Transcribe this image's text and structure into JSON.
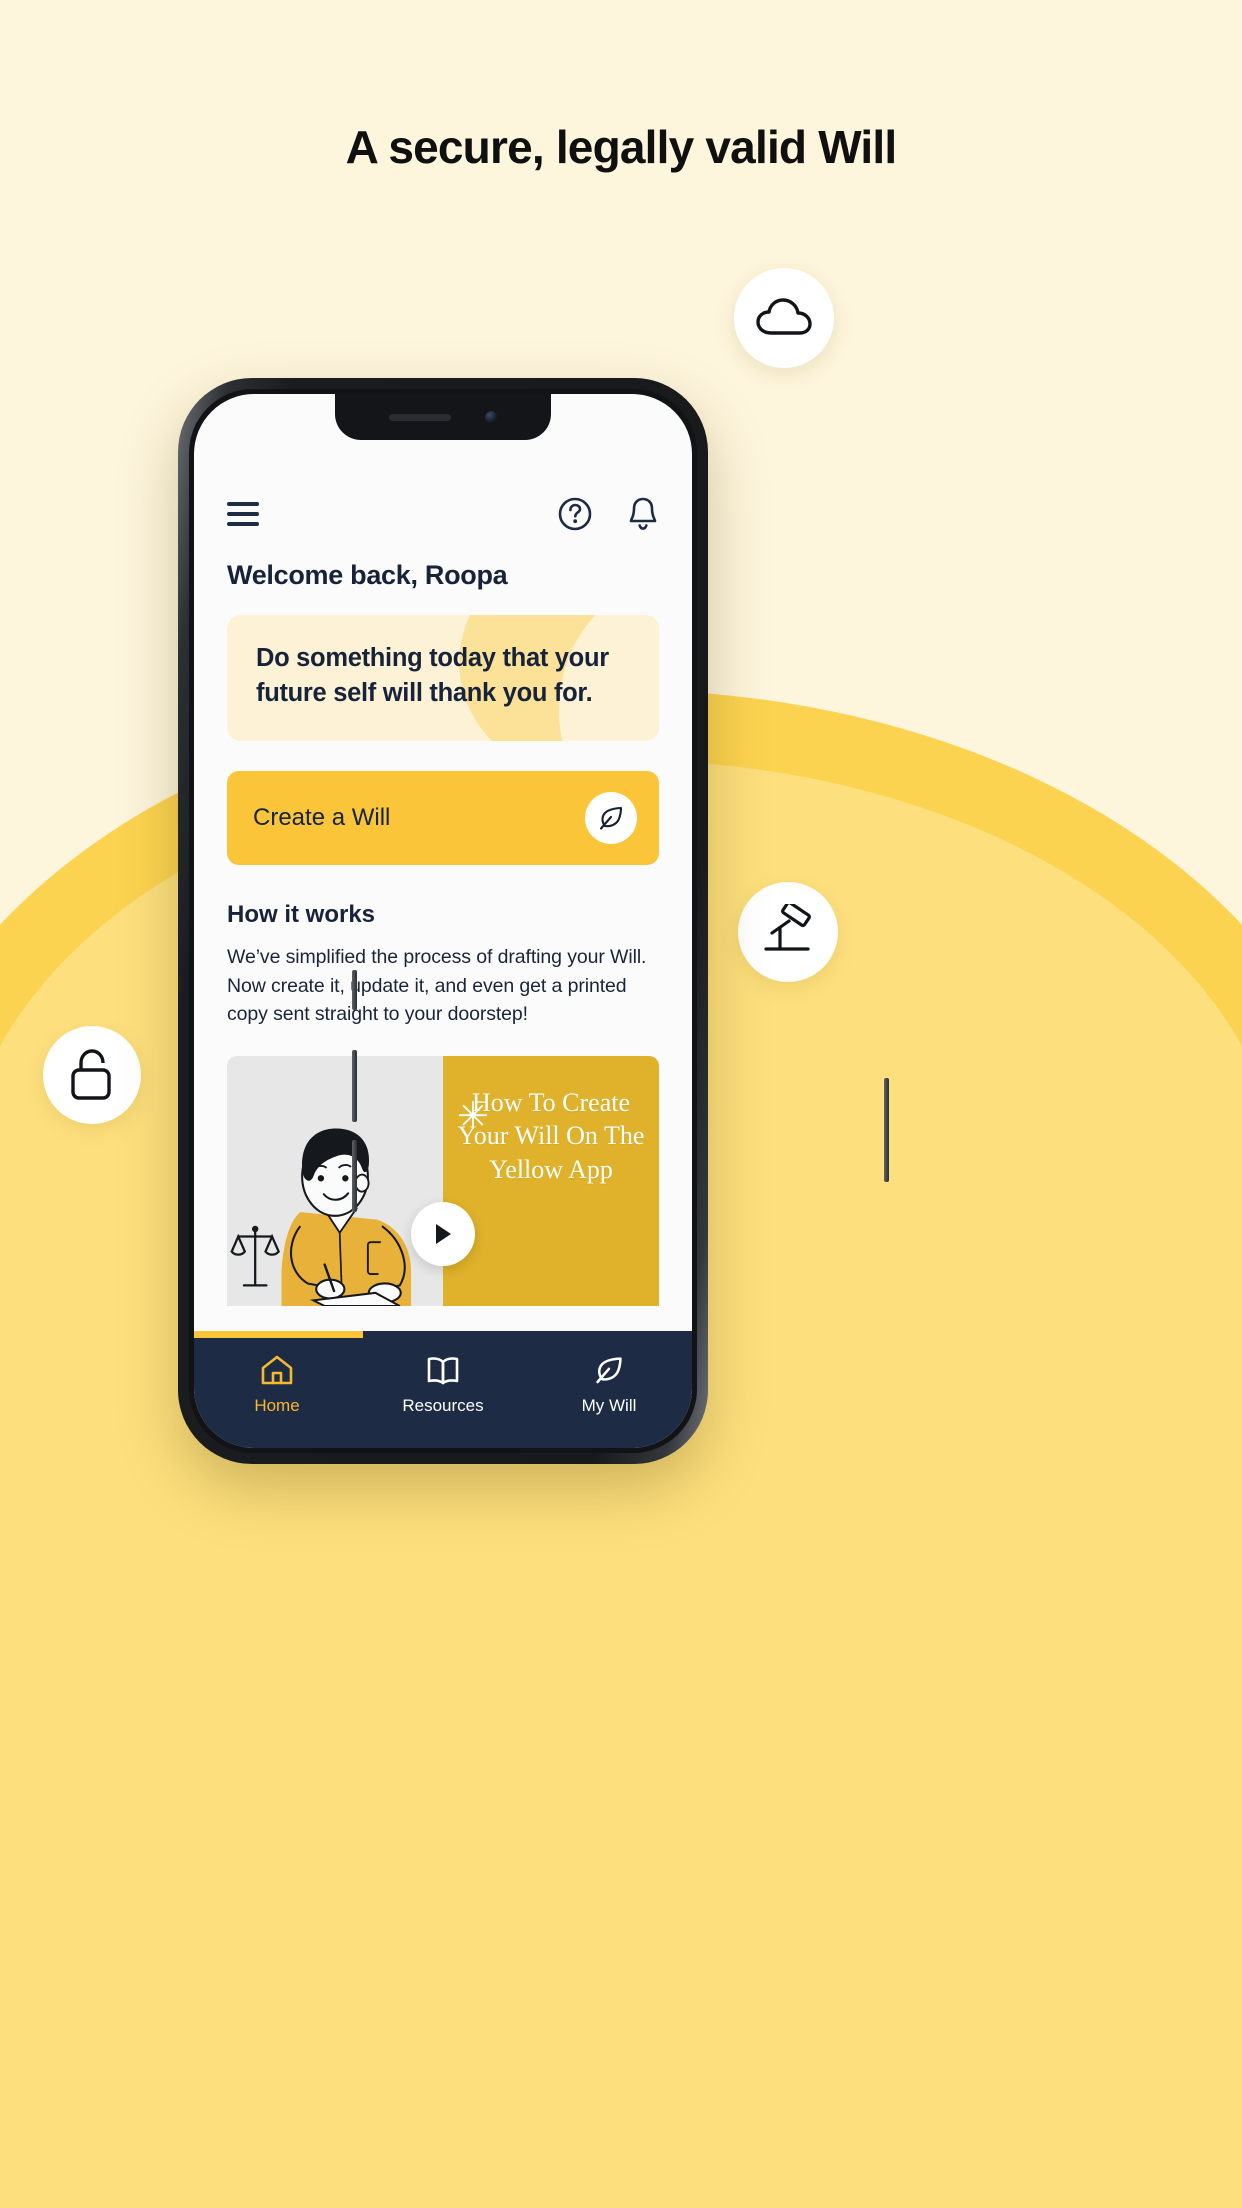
{
  "page": {
    "headline": "A secure, legally valid Will",
    "background_color": "#fdf5dc",
    "blob_color": "#fcd350",
    "blob_inner_color": "#fde07d"
  },
  "badges": [
    {
      "name": "cloud-badge",
      "icon": "cloud-icon"
    },
    {
      "name": "gavel-badge",
      "icon": "gavel-icon"
    },
    {
      "name": "lock-badge",
      "icon": "lock-icon"
    }
  ],
  "app": {
    "header": {
      "menu_icon": "hamburger-icon",
      "help_icon": "help-circle-icon",
      "notification_icon": "bell-icon"
    },
    "welcome": "Welcome back, Roopa",
    "quote": "Do something today that your future self will thank you for.",
    "cta": {
      "label": "Create a Will",
      "icon": "feather-icon",
      "color": "#fbc53a"
    },
    "how_it_works": {
      "title": "How it works",
      "body": "We’ve simplified the process of drafting your Will. Now create it, update it, and even get a printed copy sent straight to your doorstep!"
    },
    "video": {
      "asterisk": "✳",
      "title": "How To Create Your Will On The Yellow App",
      "play_icon": "play-icon",
      "left_bg": "#e7e7e7",
      "right_bg": "#e0b22b"
    },
    "progress": {
      "percent": 34,
      "track_color": "#1d2b44",
      "fill_color": "#fbc53a"
    },
    "bottom_nav": {
      "background": "#1d2b44",
      "active_color": "#f5b82e",
      "items": [
        {
          "label": "Home",
          "icon": "home-icon",
          "active": true
        },
        {
          "label": "Resources",
          "icon": "book-icon",
          "active": false
        },
        {
          "label": "My Will",
          "icon": "feather-icon",
          "active": false
        }
      ]
    }
  }
}
